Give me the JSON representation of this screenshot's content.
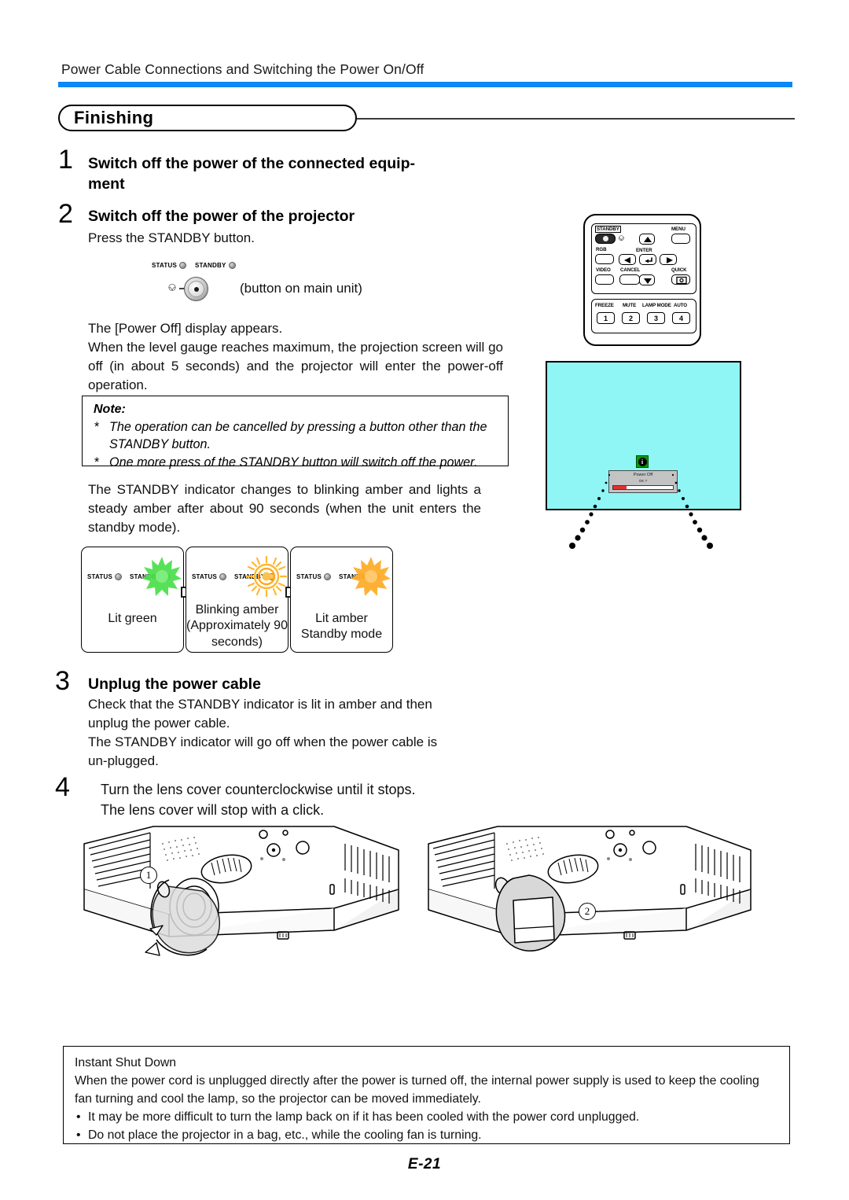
{
  "page": {
    "running_header": "Power Cable Connections and Switching the Power On/Off",
    "section_title": "Finishing",
    "page_number": "E-21",
    "accent_blue": "#0d86f7",
    "screen_cyan": "#8ff5f5"
  },
  "steps": {
    "step1": {
      "number": "1",
      "title": "Switch off the power of the connected equip-\nment"
    },
    "step2": {
      "number": "2",
      "title": "Switch off the power of the projector",
      "line1": "Press the STANDBY button.",
      "button_caption": "(button on main unit)",
      "para": "The [Power Off] display appears.\nWhen the level gauge reaches maximum, the projection screen will go off (in about 5 seconds) and the projector will enter the power-off operation.",
      "para_after_note": "The STANDBY indicator changes to blinking amber and lights a steady amber after about 90 seconds (when the unit enters the standby mode)."
    },
    "step3": {
      "number": "3",
      "title": "Unplug the power cable",
      "para": "Check that the STANDBY indicator is lit in amber and then unplug the power cable.\nThe STANDBY indicator will go off when the power cable is un-plugged."
    },
    "step4": {
      "number": "4",
      "title": "Turn the lens cover counterclockwise until it stops.\nThe lens cover will stop with a click."
    }
  },
  "note": {
    "title": "Note:",
    "items": [
      "The operation can be cancelled by pressing a button other than the STANDBY button.",
      "One more press of the STANDBY button will switch off the power."
    ]
  },
  "indicators": {
    "status_label": "STATUS",
    "standby_label": "STANDBY",
    "states": [
      {
        "caption": "Lit green",
        "color": "#3fd13f"
      },
      {
        "caption": "Blinking amber\n(Approximately 90\nseconds)",
        "color": "#ffa81f"
      },
      {
        "caption": "Lit amber\nStandby mode",
        "color": "#ffa81f"
      }
    ]
  },
  "osd": {
    "title": "Power Off",
    "subtitle": "OK ?",
    "gauge_percent": 22
  },
  "remote": {
    "keys": {
      "standby": "STANDBY",
      "menu": "MENU",
      "rgb": "RGB",
      "enter": "ENTER",
      "video": "VIDEO",
      "cancel": "CANCEL",
      "quick": "QUICK"
    },
    "function_keys": [
      {
        "label": "FREEZE",
        "digit": "1"
      },
      {
        "label": "MUTE",
        "digit": "2"
      },
      {
        "label": "LAMP MODE",
        "digit": "3"
      },
      {
        "label": "AUTO",
        "digit": "4"
      }
    ]
  },
  "projector_callouts": {
    "left": "1",
    "right": "2"
  },
  "instant_shut_down": {
    "title": "Instant Shut Down",
    "para": "When the power cord is unplugged directly after the power is turned off, the internal power supply is used to keep the cooling fan turning and cool the lamp, so the projector can be moved immediately.",
    "bullets": [
      "It may be more difficult to turn the lamp back on if it has been cooled with the power cord unplugged.",
      "Do not place the projector in a bag, etc., while the cooling fan is turning."
    ]
  }
}
